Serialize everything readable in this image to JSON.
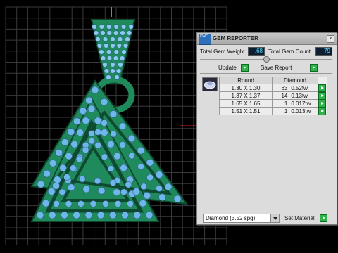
{
  "panel": {
    "title": "GEM REPORTER",
    "icon_label": "KWC",
    "total_weight_label": "Total Gem Weight",
    "total_weight_value": ".68",
    "total_count_label": "Total Gem Count",
    "total_count_value": "79",
    "update_label": "Update",
    "save_report_label": "Save Report",
    "table": {
      "headers": [
        "Round",
        "Diamond"
      ],
      "rows": [
        {
          "size": "1.30 X 1.30",
          "count": "63",
          "weight": "0.52tw"
        },
        {
          "size": "1.37 X 1.37",
          "count": "14",
          "weight": "0.13tw"
        },
        {
          "size": "1.65 X 1.65",
          "count": "1",
          "weight": "0.017tw"
        },
        {
          "size": "1.51 X 1.51",
          "count": "1",
          "weight": "0.013tw"
        }
      ]
    },
    "material_value": "Diamond   (3.52 spg)",
    "set_material_label": "Set Material"
  },
  "colors": {
    "metal": "#1f8a5c",
    "metal_dark": "#0e4a30",
    "gem": "#6fb7ea",
    "grid": "#3a3a3a",
    "accent_red": "#d42222"
  }
}
